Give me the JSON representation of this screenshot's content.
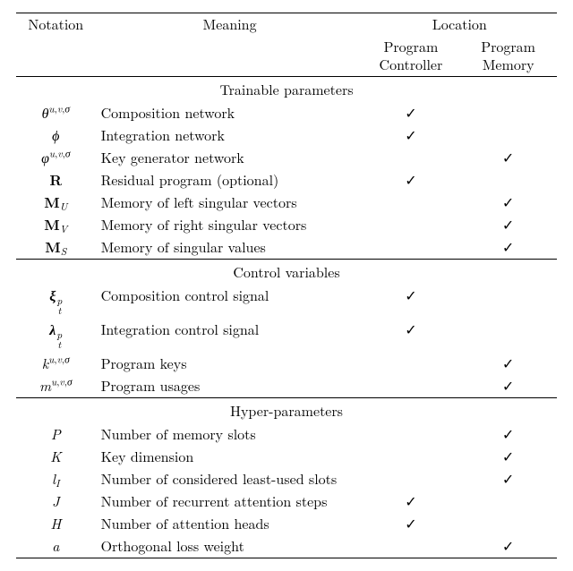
{
  "tick": "✓",
  "header": {
    "notation": "Notation",
    "meaning": "Meaning",
    "location": "Location",
    "controller_l1": "Program",
    "controller_l2": "Controller",
    "memory_l1": "Program",
    "memory_l2": "Memory"
  },
  "sections": {
    "trainable": "Trainable parameters",
    "control": "Control variables",
    "hyper": "Hyper-parameters"
  },
  "rows": {
    "theta": {
      "meaning": "Composition network",
      "ctrl": true,
      "mem": false
    },
    "phi": {
      "meaning": "Integration network",
      "ctrl": true,
      "mem": false
    },
    "varphi": {
      "meaning": "Key generator network",
      "ctrl": false,
      "mem": true
    },
    "R": {
      "meaning": "Residual program (optional)",
      "ctrl": true,
      "mem": false
    },
    "MU": {
      "meaning": "Memory of left singular vectors",
      "ctrl": false,
      "mem": true
    },
    "MV": {
      "meaning": "Memory of right singular vectors",
      "ctrl": false,
      "mem": true
    },
    "MS": {
      "meaning": "Memory of singular values",
      "ctrl": false,
      "mem": true
    },
    "xi": {
      "meaning": "Composition control signal",
      "ctrl": true,
      "mem": false
    },
    "lambda": {
      "meaning": "Integration control signal",
      "ctrl": true,
      "mem": false
    },
    "k": {
      "meaning": "Program keys",
      "ctrl": false,
      "mem": true
    },
    "m": {
      "meaning": "Program usages",
      "ctrl": false,
      "mem": true
    },
    "P": {
      "meaning": "Number of memory slots",
      "ctrl": false,
      "mem": true
    },
    "K": {
      "meaning": "Key dimension",
      "ctrl": false,
      "mem": true
    },
    "lI": {
      "meaning": "Number of considered least-used slots",
      "ctrl": false,
      "mem": true
    },
    "J": {
      "meaning": "Number of recurrent attention steps",
      "ctrl": true,
      "mem": false
    },
    "H": {
      "meaning": "Number of attention heads",
      "ctrl": true,
      "mem": false
    },
    "a": {
      "meaning": "Orthogonal loss weight",
      "ctrl": false,
      "mem": true
    }
  },
  "chart_data": {
    "type": "table",
    "title": "Notation table",
    "columns": [
      "Notation",
      "Meaning",
      "Program Controller",
      "Program Memory"
    ],
    "sections": [
      {
        "name": "Trainable parameters",
        "rows": [
          [
            "θ^{u,v,σ}",
            "Composition network",
            true,
            false
          ],
          [
            "φ",
            "Integration network",
            true,
            false
          ],
          [
            "ϕ^{u,v,σ}",
            "Key generator network",
            false,
            true
          ],
          [
            "R",
            "Residual program (optional)",
            true,
            false
          ],
          [
            "M_U",
            "Memory of left singular vectors",
            false,
            true
          ],
          [
            "M_V",
            "Memory of right singular vectors",
            false,
            true
          ],
          [
            "M_S",
            "Memory of singular values",
            false,
            true
          ]
        ]
      },
      {
        "name": "Control variables",
        "rows": [
          [
            "ξ_t^p",
            "Composition control signal",
            true,
            false
          ],
          [
            "λ_t^p",
            "Integration control signal",
            true,
            false
          ],
          [
            "k^{u,v,σ}",
            "Program keys",
            false,
            true
          ],
          [
            "m^{u,v,σ}",
            "Program usages",
            false,
            true
          ]
        ]
      },
      {
        "name": "Hyper-parameters",
        "rows": [
          [
            "P",
            "Number of memory slots",
            false,
            true
          ],
          [
            "K",
            "Key dimension",
            false,
            true
          ],
          [
            "l_I",
            "Number of considered least-used slots",
            false,
            true
          ],
          [
            "J",
            "Number of recurrent attention steps",
            true,
            false
          ],
          [
            "H",
            "Number of attention heads",
            true,
            false
          ],
          [
            "a",
            "Orthogonal loss weight",
            false,
            true
          ]
        ]
      }
    ]
  }
}
